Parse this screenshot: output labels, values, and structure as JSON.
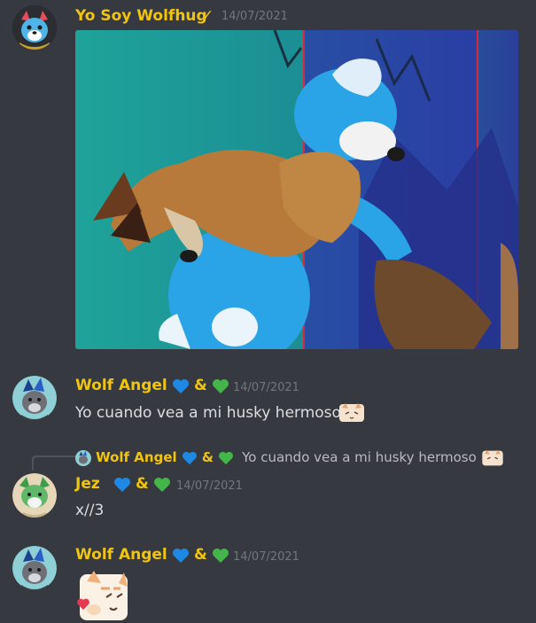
{
  "messages": [
    {
      "author": "Yo Soy Wolfhug",
      "verified_mark": "✓",
      "timestamp": "14/07/2021",
      "avatar_icon": "blue-wolf-avatar-icon",
      "attachment": "image"
    },
    {
      "author": "Wolf Angel",
      "amp": "&",
      "timestamp": "14/07/2021",
      "text": "Yo cuando vea a mi husky hermoso",
      "avatar_icon": "wolf-angel-avatar-icon"
    },
    {
      "reply_author": "Wolf Angel",
      "reply_amp": "&",
      "reply_text": "Yo cuando vea a mi husky hermoso",
      "author": "Jez",
      "amp": "&",
      "timestamp": "14/07/2021",
      "text": "x//3",
      "avatar_icon": "green-cat-avatar-icon"
    },
    {
      "author": "Wolf Angel",
      "amp": "&",
      "timestamp": "14/07/2021",
      "avatar_icon": "wolf-angel-avatar-icon",
      "sticker": "cat-kiss-sticker"
    }
  ],
  "colors": {
    "background": "#36393f",
    "name": "#f1c40f",
    "timestamp": "#72767d",
    "text": "#dcddde",
    "blue_heart": "#1e88e5",
    "green_heart": "#43b649"
  }
}
